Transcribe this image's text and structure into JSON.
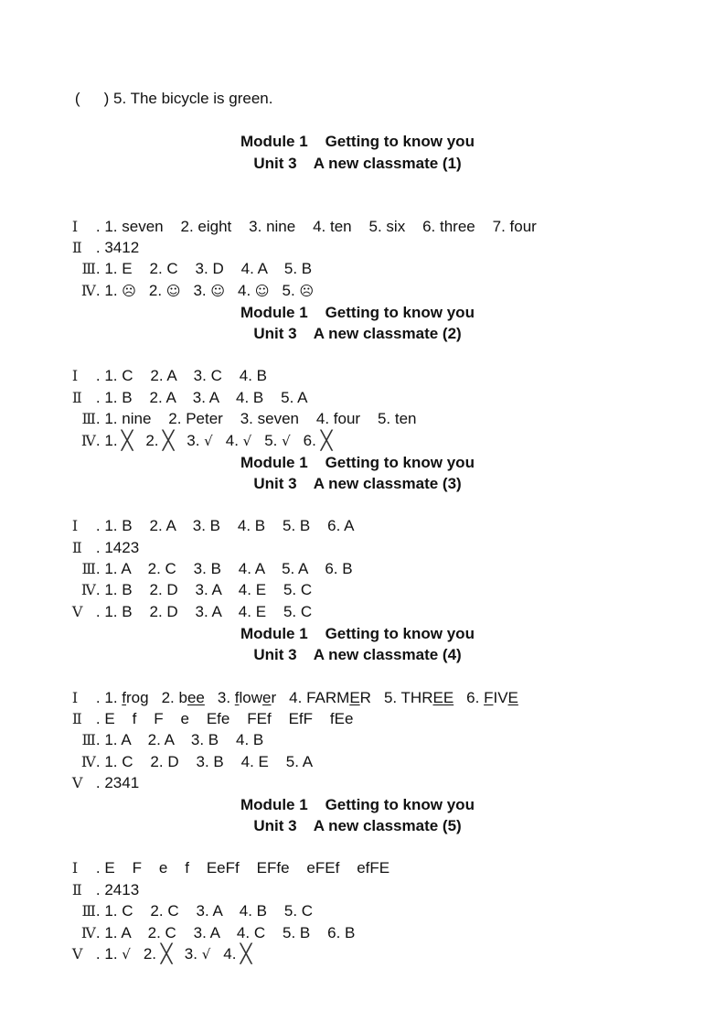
{
  "top_question": {
    "paren_open": "(",
    "paren_close": ")",
    "text": "5. The bicycle is green."
  },
  "sections": [
    {
      "module_title": "Module 1    Getting to know you",
      "unit_title": "Unit 3    A new classmate (1)",
      "answers": [
        {
          "numeral": "Ⅰ",
          "text": ". 1. seven    2. eight    3. nine    4. ten    5. six    6. three    7. four"
        },
        {
          "numeral": "Ⅱ",
          "text": ". 3412"
        },
        {
          "numeral": "Ⅲ",
          "text": ". 1. E    2. C    3. D    4. A    5. B"
        },
        {
          "numeral": "Ⅳ",
          "items": [
            {
              "num": "1.",
              "mark": "sad-face",
              "glyph": "☹"
            },
            {
              "num": "2.",
              "mark": "smiley-face",
              "glyph": "☺"
            },
            {
              "num": "3.",
              "mark": "smiley-face",
              "glyph": "☺"
            },
            {
              "num": "4.",
              "mark": "smiley-face",
              "glyph": "☺"
            },
            {
              "num": "5.",
              "mark": "sad-face",
              "glyph": "☹"
            }
          ]
        }
      ]
    },
    {
      "module_title": "Module 1    Getting to know you",
      "unit_title": "Unit 3    A new classmate (2)",
      "answers": [
        {
          "numeral": "Ⅰ",
          "text": ". 1. C    2. A    3. C    4. B"
        },
        {
          "numeral": "Ⅱ",
          "text": ". 1. B    2. A    3. A    4. B    5. A"
        },
        {
          "numeral": "Ⅲ",
          "text": ". 1. nine    2. Peter    3. seven    4. four    5. ten"
        },
        {
          "numeral": "Ⅳ",
          "items": [
            {
              "num": "1.",
              "mark": "cross",
              "glyph": "╳"
            },
            {
              "num": "2.",
              "mark": "cross",
              "glyph": "╳"
            },
            {
              "num": "3.",
              "mark": "check",
              "glyph": "√"
            },
            {
              "num": "4.",
              "mark": "check",
              "glyph": "√"
            },
            {
              "num": "5.",
              "mark": "check",
              "glyph": "√"
            },
            {
              "num": "6.",
              "mark": "cross",
              "glyph": "╳"
            }
          ]
        }
      ]
    },
    {
      "module_title": "Module 1    Getting to know you",
      "unit_title": "Unit 3    A new classmate (3)",
      "answers": [
        {
          "numeral": "Ⅰ",
          "text": ". 1. B    2. A    3. B    4. B    5. B    6. A"
        },
        {
          "numeral": "Ⅱ",
          "text": ". 1423"
        },
        {
          "numeral": "Ⅲ",
          "text": ". 1. A    2. C    3. B    4. A    5. A    6. B"
        },
        {
          "numeral": "Ⅳ",
          "text": ". 1. B    2. D    3. A    4. E    5. C"
        },
        {
          "numeral": "Ⅴ",
          "text": ". 1. B    2. D    3. A    4. E    5. C"
        }
      ]
    },
    {
      "module_title": "Module 1    Getting to know you",
      "unit_title": "Unit 3    A new classmate (4)",
      "answers": [
        {
          "numeral": "Ⅰ",
          "words": [
            {
              "num": "1.",
              "parts": [
                {
                  "t": "f",
                  "u": true
                },
                {
                  "t": "rog",
                  "u": false
                }
              ]
            },
            {
              "num": "2.",
              "parts": [
                {
                  "t": "b",
                  "u": false
                },
                {
                  "t": "ee",
                  "u": true
                }
              ]
            },
            {
              "num": "3.",
              "parts": [
                {
                  "t": "f",
                  "u": true
                },
                {
                  "t": "low",
                  "u": false
                },
                {
                  "t": "e",
                  "u": true
                },
                {
                  "t": "r",
                  "u": false
                }
              ]
            },
            {
              "num": "4.",
              "parts": [
                {
                  "t": "FARM",
                  "u": false
                },
                {
                  "t": "E",
                  "u": true
                },
                {
                  "t": "R",
                  "u": false
                }
              ]
            },
            {
              "num": "5.",
              "parts": [
                {
                  "t": "THR",
                  "u": false
                },
                {
                  "t": "EE",
                  "u": true
                }
              ]
            },
            {
              "num": "6.",
              "parts": [
                {
                  "t": "F",
                  "u": true
                },
                {
                  "t": "IV",
                  "u": false
                },
                {
                  "t": "E",
                  "u": true
                }
              ]
            }
          ]
        },
        {
          "numeral": "Ⅱ",
          "text": ". E    f    F    e    Efe    FEf    EfF    fEe"
        },
        {
          "numeral": "Ⅲ",
          "text": ". 1. A    2. A    3. B    4. B"
        },
        {
          "numeral": "Ⅳ",
          "text": ". 1. C    2. D    3. B    4. E    5. A"
        },
        {
          "numeral": "Ⅴ",
          "text": ". 2341"
        }
      ]
    },
    {
      "module_title": "Module 1    Getting to know you",
      "unit_title": "Unit 3    A new classmate (5)",
      "answers": [
        {
          "numeral": "Ⅰ",
          "text": ". E    F    e    f    EeFf    EFfe    eFEf    efFE"
        },
        {
          "numeral": "Ⅱ",
          "text": ". 2413"
        },
        {
          "numeral": "Ⅲ",
          "text": ". 1. C    2. C    3. A    4. B    5. C"
        },
        {
          "numeral": "Ⅳ",
          "text": ". 1. A    2. C    3. A    4. C    5. B    6. B"
        },
        {
          "numeral": "Ⅴ",
          "items": [
            {
              "num": "1.",
              "mark": "check",
              "glyph": "√"
            },
            {
              "num": "2.",
              "mark": "cross",
              "glyph": "╳"
            },
            {
              "num": "3.",
              "mark": "check",
              "glyph": "√"
            },
            {
              "num": "4.",
              "mark": "cross",
              "glyph": "╳"
            }
          ]
        }
      ]
    }
  ]
}
